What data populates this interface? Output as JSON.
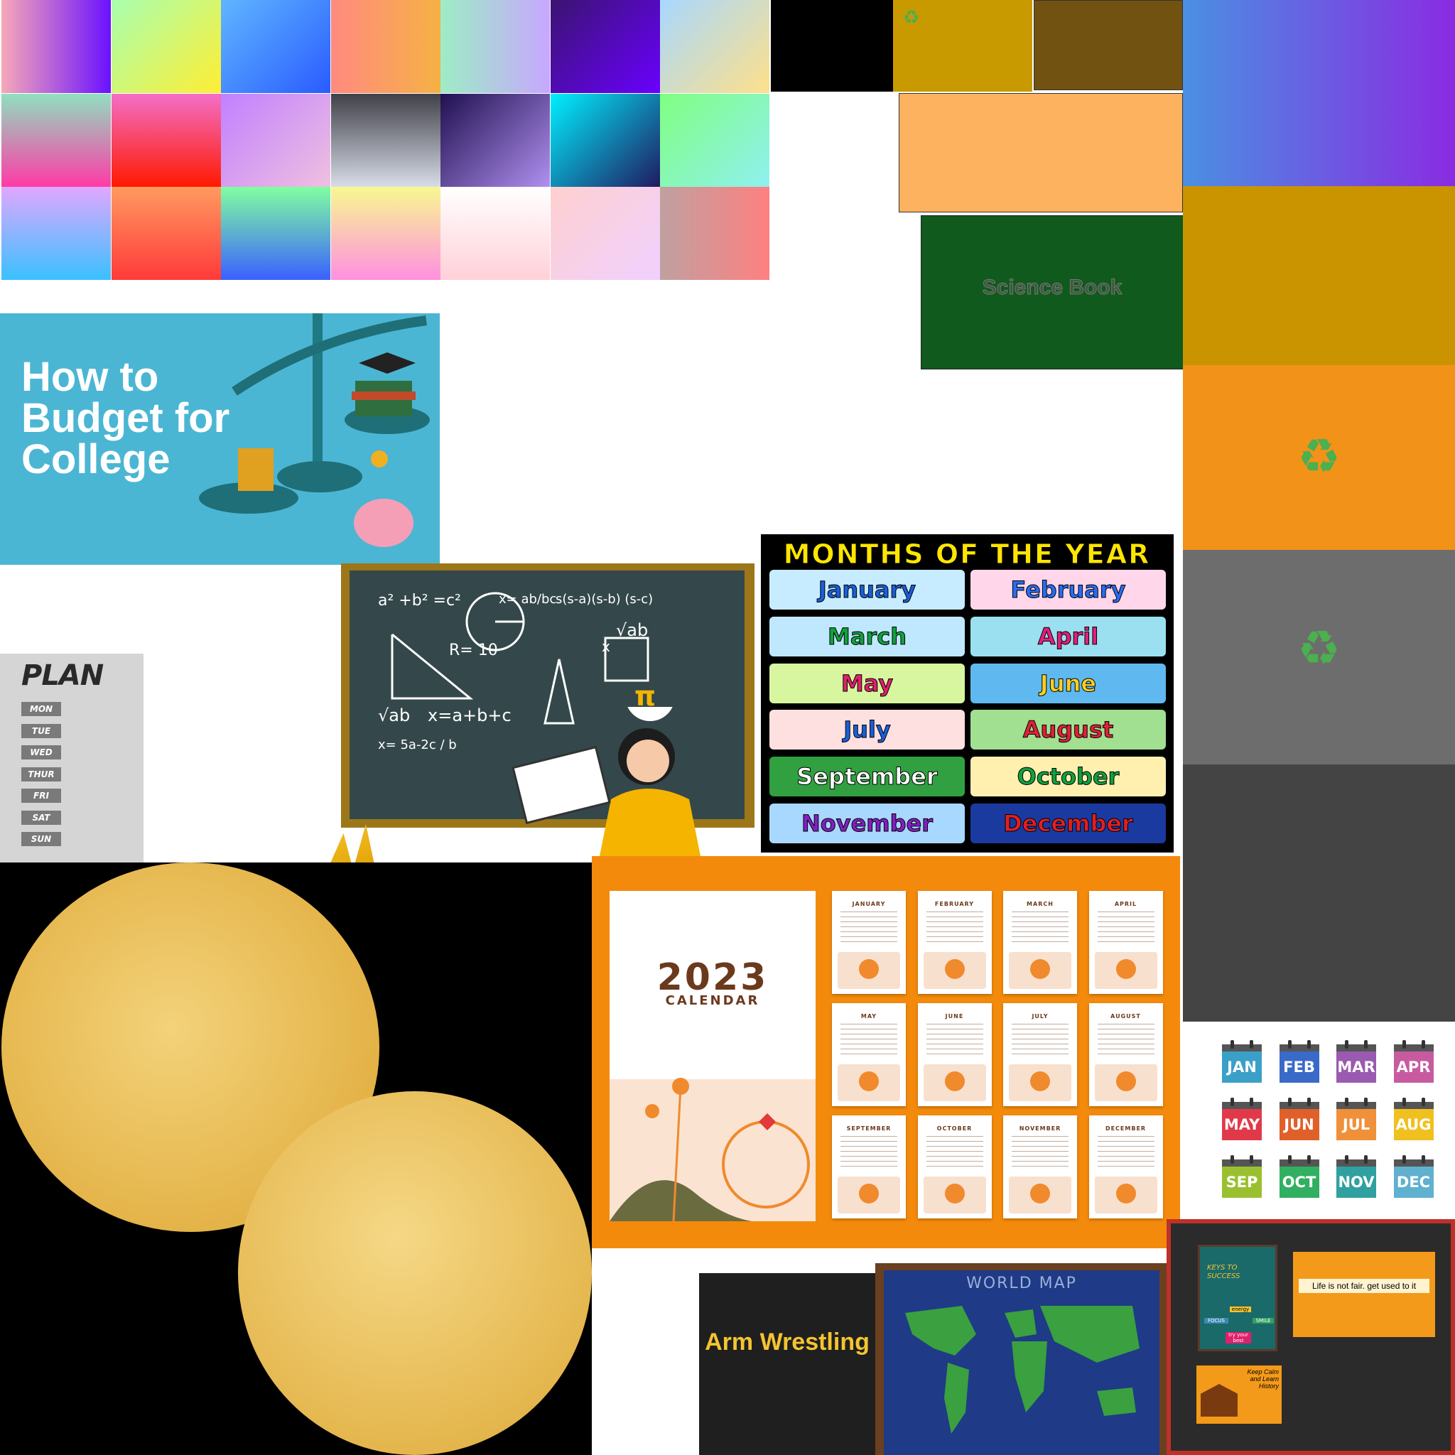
{
  "swatches": [
    {
      "g": "linear-gradient(90deg,#f7a8b8,#6a11ff)"
    },
    {
      "g": "linear-gradient(135deg,#a8ffb0,#ffee33)"
    },
    {
      "g": "linear-gradient(135deg,#5fb6ff,#2a5bff)"
    },
    {
      "g": "linear-gradient(90deg,#ff8a80,#f6b144)"
    },
    {
      "g": "linear-gradient(90deg,#9dedc5,#c8a7ff)"
    },
    {
      "g": "linear-gradient(135deg,#3a1470,#6a00ff)"
    },
    {
      "g": "linear-gradient(135deg,#a8d8ff,#ffe08a)"
    },
    {
      "g": "linear-gradient(180deg,#8fe0c0,#ff3aa6)"
    },
    {
      "g": "linear-gradient(180deg,#f36fc7,#ff1a00)"
    },
    {
      "g": "linear-gradient(135deg,#c080ff,#f0c0e0)"
    },
    {
      "g": "linear-gradient(180deg,#404048,#d8dde8)"
    },
    {
      "g": "linear-gradient(135deg,#201050,#b090f0)"
    },
    {
      "g": "linear-gradient(135deg,#00f0ff,#201a60)"
    },
    {
      "g": "linear-gradient(135deg,#80ff80,#90f0f0)"
    },
    {
      "g": "linear-gradient(180deg,#e0a8ff,#3ac0ff)"
    },
    {
      "g": "linear-gradient(180deg,#ff9a60,#ff3a3a)"
    },
    {
      "g": "linear-gradient(180deg,#80ffa0,#3a60ff)"
    },
    {
      "g": "linear-gradient(180deg,#f8f890,#ff90e0)"
    },
    {
      "g": "linear-gradient(180deg,#ffffff,#ffd0d8)"
    },
    {
      "g": "linear-gradient(135deg,#ffd0d0,#f0d0ff)"
    },
    {
      "g": "linear-gradient(90deg,#c0a0a0,#ff8080)"
    }
  ],
  "budget": {
    "title": "How to Budget for College",
    "bg": "#4bb6d3"
  },
  "science_book": {
    "title": "Science Book"
  },
  "plan": {
    "title": "PLAN",
    "days": [
      "MON",
      "TUE",
      "WED",
      "THUR",
      "FRI",
      "SAT",
      "SUN"
    ]
  },
  "chalkboard": {
    "formulas": [
      "a² +b² =c²",
      "x= ab/bc",
      "s(s-a)(s-b) (s-c)",
      "√ab",
      "R= 10",
      "x",
      "√ab",
      "x=a+b+c",
      "x= 5a-2c / b",
      "π"
    ]
  },
  "months_poster": {
    "title": "MONTHS OF THE YEAR",
    "months": [
      {
        "name": "January",
        "color": "#1a5fd6",
        "bg": "#c8ecff"
      },
      {
        "name": "February",
        "color": "#2a6cf0",
        "bg": "#ffd6ea"
      },
      {
        "name": "March",
        "color": "#12a040",
        "bg": "#bfe8ff"
      },
      {
        "name": "April",
        "color": "#e0207a",
        "bg": "#9be0f0"
      },
      {
        "name": "May",
        "color": "#e0206a",
        "bg": "#d8f5a0"
      },
      {
        "name": "June",
        "color": "#ffd020",
        "bg": "#5fb8f0"
      },
      {
        "name": "July",
        "color": "#1a5fd6",
        "bg": "#ffe0e0"
      },
      {
        "name": "August",
        "color": "#e0203a",
        "bg": "#a0e090"
      },
      {
        "name": "September",
        "color": "#ffffff",
        "bg": "#30a040"
      },
      {
        "name": "October",
        "color": "#12a040",
        "bg": "#fff0b0"
      },
      {
        "name": "November",
        "color": "#8020c0",
        "bg": "#a8d8ff"
      },
      {
        "name": "December",
        "color": "#e02020",
        "bg": "#1a3aa0"
      }
    ]
  },
  "calendar2023": {
    "year": "2023",
    "label": "CALENDAR",
    "months": [
      "JANUARY",
      "FEBRUARY",
      "MARCH",
      "APRIL",
      "MAY",
      "JUNE",
      "JULY",
      "AUGUST",
      "SEPTEMBER",
      "OCTOBER",
      "NOVEMBER",
      "DECEMBER"
    ]
  },
  "month_icons": [
    {
      "label": "JAN",
      "color": "#3aa0c8"
    },
    {
      "label": "FEB",
      "color": "#3a6ac8"
    },
    {
      "label": "MAR",
      "color": "#9a5ab0"
    },
    {
      "label": "APR",
      "color": "#c85aa0"
    },
    {
      "label": "MAY",
      "color": "#e03a4a"
    },
    {
      "label": "JUN",
      "color": "#e0602a"
    },
    {
      "label": "JUL",
      "color": "#f0903a"
    },
    {
      "label": "AUG",
      "color": "#f0c020"
    },
    {
      "label": "SEP",
      "color": "#9ac030"
    },
    {
      "label": "OCT",
      "color": "#30b060"
    },
    {
      "label": "NOV",
      "color": "#30a0a0"
    },
    {
      "label": "DEC",
      "color": "#60b0d0"
    }
  ],
  "arm_wrestling": {
    "title": "Arm Wrestling"
  },
  "world_map": {
    "title": "WORLD MAP"
  },
  "bulletin": {
    "keys_title": "KEYS TO SUCCESS",
    "lock_labels": [
      "FOCUS",
      "energy",
      "SMILE",
      "try your best"
    ],
    "quote": "Life is not fair. get used to it",
    "history": "Keep Calm and Learn History"
  },
  "recycle_glyph": "♻"
}
